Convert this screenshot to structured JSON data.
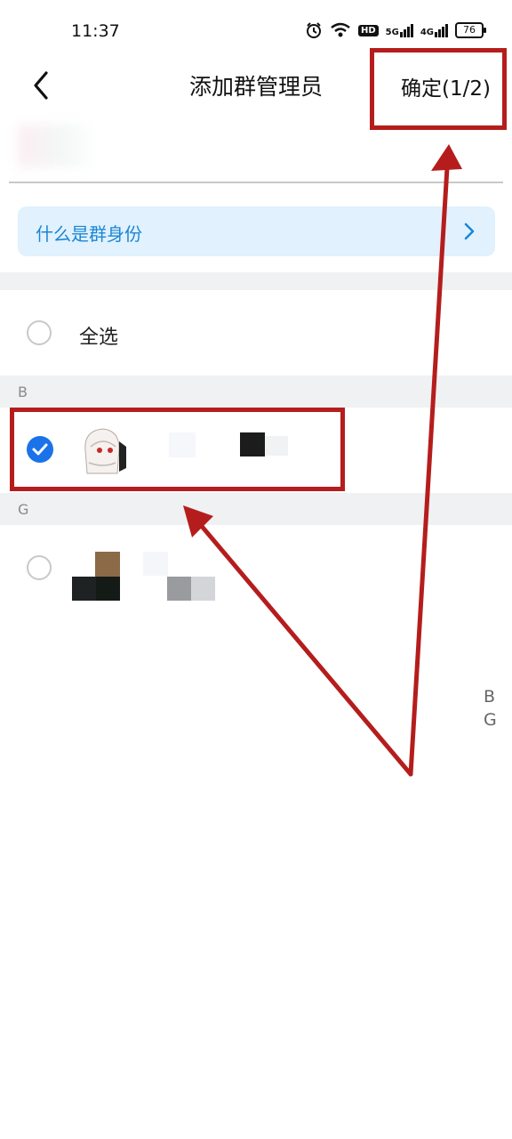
{
  "status_bar": {
    "time": "11:37",
    "hd": "HD",
    "net1": "5G",
    "net2": "4G",
    "battery": "76"
  },
  "header": {
    "title": "添加群管理员",
    "confirm_label": "确定(1/2)"
  },
  "info_bar": {
    "text": "什么是群身份"
  },
  "select_all": {
    "label": "全选"
  },
  "sections": [
    {
      "letter": "B"
    },
    {
      "letter": "G"
    }
  ],
  "index_bar": [
    "B",
    "G"
  ],
  "colors": {
    "accent": "#1a73e8",
    "info_text": "#1a86d6",
    "info_bg": "#e1f1fd",
    "annotation_red": "#b51d1d"
  }
}
